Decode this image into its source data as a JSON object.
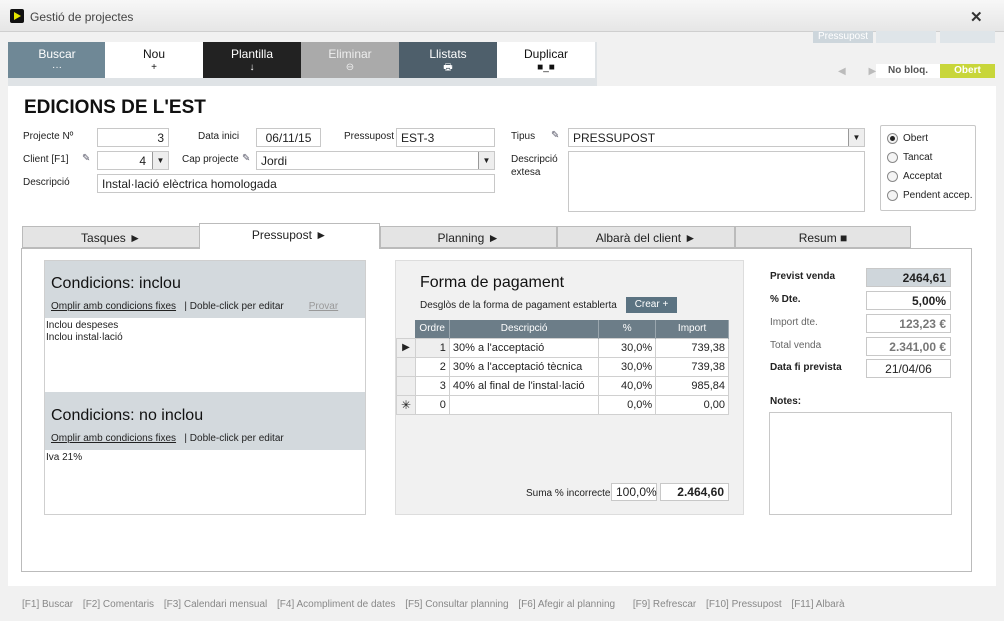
{
  "window": {
    "title": "Gestió de projectes",
    "close": "✕"
  },
  "toolbar": [
    {
      "label": "Buscar",
      "sym": "···"
    },
    {
      "label": "Nou",
      "sym": "+"
    },
    {
      "label": "Plantilla",
      "sym": "↓"
    },
    {
      "label": "Eliminar",
      "sym": "⊖"
    },
    {
      "label": "Llistats",
      "sym": "🖶"
    },
    {
      "label": "Duplicar",
      "sym": "■_■"
    }
  ],
  "topright": {
    "tag": "Pressupost",
    "nav": "◀ ▶",
    "lock": "No bloq.",
    "state": "Obert"
  },
  "heading": "EDICIONS DE L'EST",
  "form": {
    "projecte_label": "Projecte Nº",
    "projecte": "3",
    "data_inici_label": "Data inici",
    "data_inici": "06/11/15",
    "pressupost_label": "Pressupost",
    "pressupost": "EST-3",
    "tipus_label": "Tipus",
    "tipus": "PRESSUPOST",
    "client_label": "Client [F1]",
    "client": "4",
    "cap_label": "Cap projecte",
    "cap": "Jordi",
    "descripcio_label": "Descripció",
    "descripcio": "Instal·lació elèctrica homologada",
    "desc_extesa_label": "Descripció extesa",
    "desc_extesa": ""
  },
  "status": {
    "options": [
      "Obert",
      "Tancat",
      "Acceptat",
      "Pendent accep."
    ],
    "selected": 0
  },
  "tabs": [
    {
      "label": "Tasques ►"
    },
    {
      "label": "Pressupost ►"
    },
    {
      "label": "Planning ►"
    },
    {
      "label": "Albarà del client ►"
    },
    {
      "label": "Resum ■"
    }
  ],
  "incl": {
    "title": "Condicions: inclou",
    "link1": "Omplir amb condicions fixes",
    "sep": "|",
    "hint": "Doble-click per editar",
    "provar": "Provar",
    "lines": [
      "Inclou despeses",
      "Inclou instal·lació"
    ]
  },
  "noincl": {
    "title": "Condicions: no inclou",
    "link1": "Omplir amb condicions fixes",
    "sep": "|",
    "hint": "Doble-click per editar",
    "lines": [
      "Iva 21%"
    ]
  },
  "pagament": {
    "title": "Forma de pagament",
    "subtitle": "Desglòs de la forma de pagament establerta",
    "crear": "Crear +",
    "headers": [
      "Ordre",
      "Descripció",
      "%",
      "Import"
    ],
    "rows": [
      {
        "marker": "▶",
        "ordre": "1",
        "desc": "30% a l'acceptació",
        "pct": "30,0%",
        "import": "739,38"
      },
      {
        "marker": "",
        "ordre": "2",
        "desc": "30% a l'acceptació tècnica",
        "pct": "30,0%",
        "import": "739,38"
      },
      {
        "marker": "",
        "ordre": "3",
        "desc": "40% al final de l'instal·lació",
        "pct": "40,0%",
        "import": "985,84"
      },
      {
        "marker": "✳",
        "ordre": "0",
        "desc": "",
        "pct": "0,0%",
        "import": "0,00"
      }
    ],
    "suma_label": "Suma % incorrecte",
    "suma_pct": "100,0%",
    "suma_total": "2.464,60"
  },
  "resum": {
    "previst_label": "Previst venda",
    "previst": "2464,61",
    "dte_label": "% Dte.",
    "dte": "5,00%",
    "import_dte_label": "Import dte.",
    "import_dte": "123,23 €",
    "total_label": "Total venda",
    "total": "2.341,00 €",
    "data_fi_label": "Data fi prevista",
    "data_fi": "21/04/06",
    "notes_label": "Notes:"
  },
  "footer": [
    "[F1] Buscar",
    "[F2] Comentaris",
    "[F3] Calendari mensual",
    "[F4] Acompliment de dates",
    "[F5] Consultar planning",
    "[F6] Afegir al planning",
    "[F9] Refrescar",
    "[F10] Pressupost",
    "[F11] Albarà"
  ]
}
